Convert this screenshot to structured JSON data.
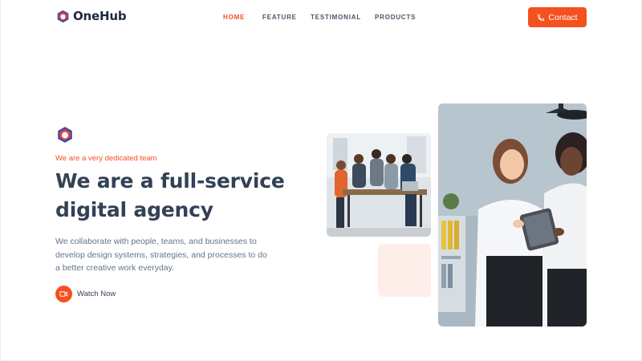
{
  "brand": {
    "name": "OneHub",
    "accent": "#f4511e"
  },
  "nav": {
    "items": [
      {
        "label": "HOME",
        "active": true
      },
      {
        "label": "FEATURE",
        "active": false
      },
      {
        "label": "TESTIMONIAL",
        "active": false
      },
      {
        "label": "PRODUCTS",
        "active": false
      }
    ],
    "contact_label": "Contact",
    "contact_icon": "phone-icon"
  },
  "hero": {
    "icon": "hexagon-logo-icon",
    "tagline": "We are a very dedicated team",
    "headline": "We are a full-service digital agency",
    "description": "We collaborate with people, teams, and businesses to develop design systems, strategies, and processes to do a better creative work everyday.",
    "watch_label": "Watch Now",
    "watch_icon": "video-camera-icon"
  },
  "images": {
    "small": "team-meeting-photo",
    "large": "two-women-with-tablet-photo"
  }
}
